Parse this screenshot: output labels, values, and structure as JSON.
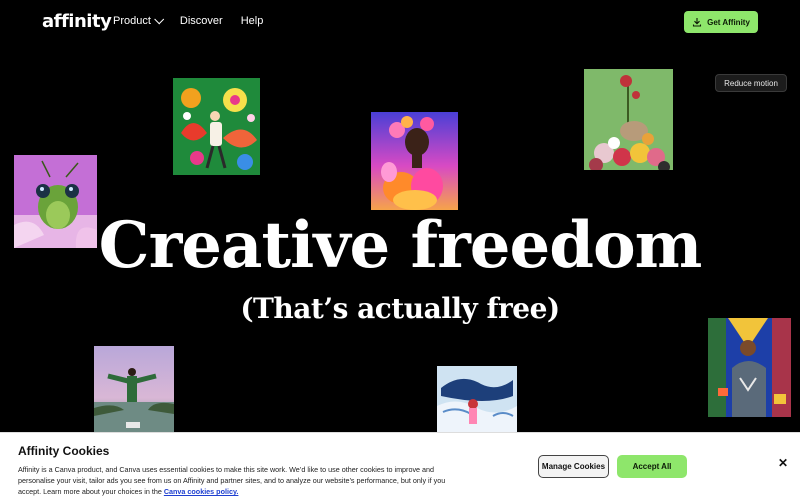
{
  "header": {
    "logo": "affinity",
    "nav": [
      {
        "label": "Product",
        "has_dropdown": true
      },
      {
        "label": "Discover"
      },
      {
        "label": "Help"
      }
    ],
    "cta_label": "Get Affinity",
    "cta_icon": "download-icon"
  },
  "controls": {
    "reduce_motion_label": "Reduce motion"
  },
  "hero": {
    "title": "Creative freedom",
    "subtitle": "(That’s actually free)"
  },
  "artworks": [
    {
      "name": "insect-artwork"
    },
    {
      "name": "flowers-illustration"
    },
    {
      "name": "floral-portrait-artwork"
    },
    {
      "name": "flower-collage-artwork"
    },
    {
      "name": "person-in-lake-photo"
    },
    {
      "name": "whale-illustration"
    },
    {
      "name": "musician-painting"
    }
  ],
  "cookie_banner": {
    "title": "Affinity Cookies",
    "body": "Affinity is a Canva product, and Canva uses essential cookies to make this site work. We’d like to use other cookies to improve and personalise your visit, tailor ads you see from us on Affinity and partner sites, and to analyze our website’s performance, but only if you accept. Learn more about your choices in the",
    "link_text": "Canva cookies policy.",
    "manage_label": "Manage Cookies",
    "accept_label": "Accept All",
    "close_label": "✕"
  },
  "colors": {
    "background": "#000000",
    "accent_green": "#8ee66b",
    "link_blue": "#1e3fd0"
  }
}
